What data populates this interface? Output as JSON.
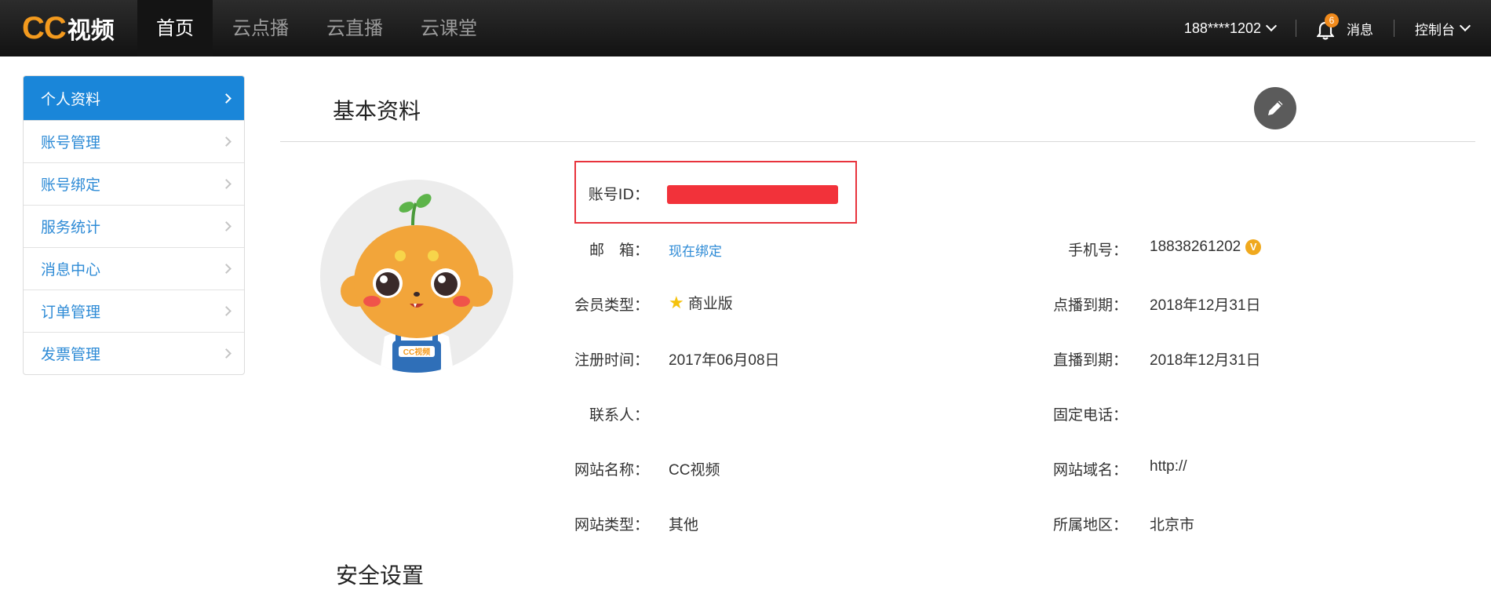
{
  "brand": {
    "cc": "CC",
    "name": "视频"
  },
  "nav": [
    {
      "label": "首页",
      "active": true
    },
    {
      "label": "云点播"
    },
    {
      "label": "云直播"
    },
    {
      "label": "云课堂"
    }
  ],
  "header": {
    "user": "188****1202",
    "notify_count": "6",
    "messages_label": "消息",
    "console_label": "控制台"
  },
  "sidebar": {
    "items": [
      {
        "label": "个人资料",
        "active": true
      },
      {
        "label": "账号管理"
      },
      {
        "label": "账号绑定"
      },
      {
        "label": "服务统计"
      },
      {
        "label": "消息中心"
      },
      {
        "label": "订单管理"
      },
      {
        "label": "发票管理"
      }
    ]
  },
  "profile": {
    "title": "基本资料",
    "avatar_text": "CC视频",
    "account_id_label": "账号ID：",
    "email_label": "邮　箱：",
    "email_link": "现在绑定",
    "member_type_label": "会员类型：",
    "member_type": "商业版",
    "register_label": "注册时间：",
    "register_date": "2017年06月08日",
    "contact_label": "联系人：",
    "site_name_label": "网站名称：",
    "site_name": "CC视频",
    "site_type_label": "网站类型：",
    "site_type": "其他",
    "phone_label": "手机号：",
    "phone": "18838261202",
    "verified_badge": "V",
    "vod_expire_label": "点播到期：",
    "vod_expire": "2018年12月31日",
    "live_expire_label": "直播到期：",
    "live_expire": "2018年12月31日",
    "landline_label": "固定电话：",
    "domain_label": "网站域名：",
    "domain": "http://",
    "region_label": "所属地区：",
    "region": "北京市"
  },
  "next_section": {
    "title": "安全设置"
  },
  "colors": {
    "accent": "#1a86d9",
    "brand_orange": "#f39a1e",
    "redact": "#f2323a"
  }
}
